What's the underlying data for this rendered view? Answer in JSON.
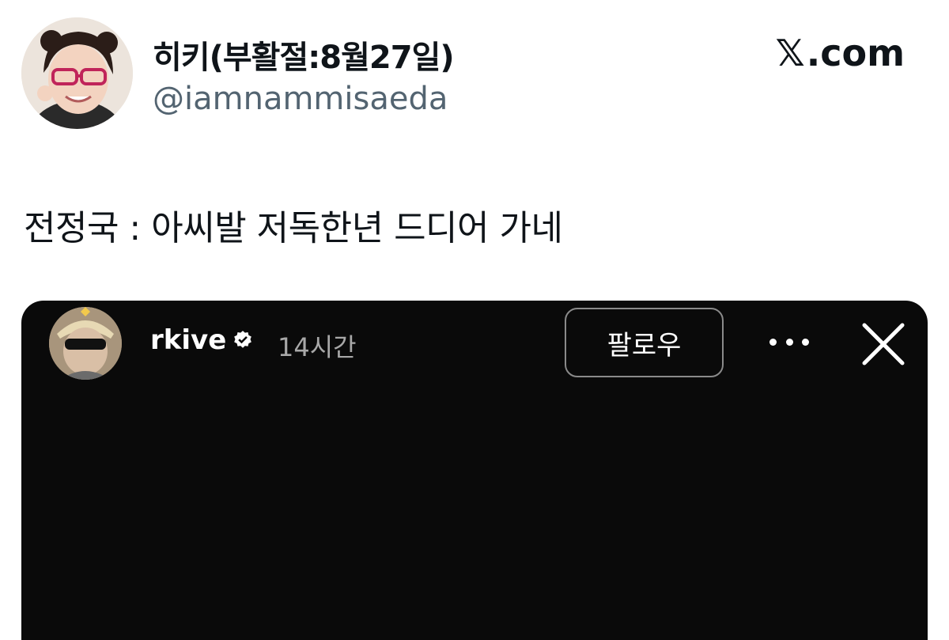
{
  "tweet": {
    "display_name": "히키(부활절:8월27일)",
    "handle": "@iamnammisaeda",
    "brand": ".com",
    "text": "전정국 : 아씨발 저독한년 드디어 가네"
  },
  "story": {
    "username": "rkive",
    "time": "14시간",
    "follow_label": "팔로우"
  },
  "icons": {
    "brand": "x-logo-icon",
    "verified": "verified-badge-icon",
    "more": "more-horizontal-icon",
    "close": "close-icon"
  },
  "colors": {
    "text_primary": "#0f1419",
    "text_secondary": "#536471",
    "media_bg": "#0a0a0a"
  }
}
